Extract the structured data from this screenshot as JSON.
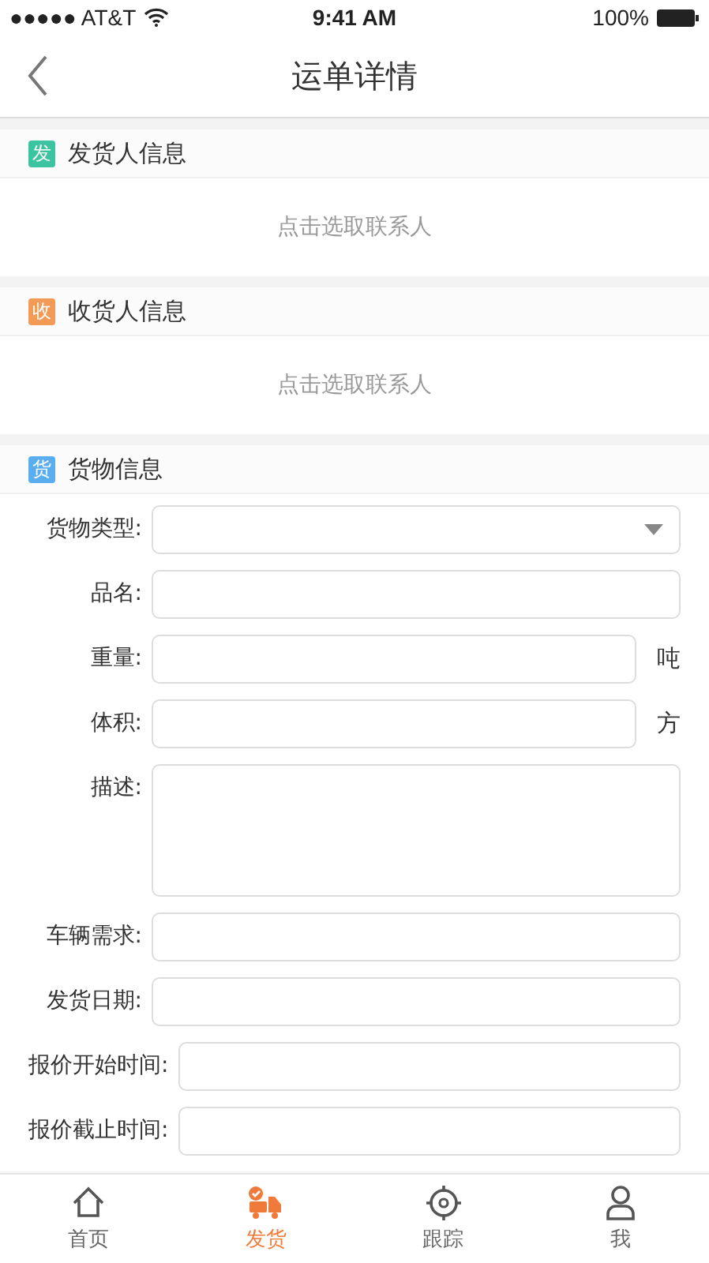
{
  "status_bar": {
    "carrier": "●●●●● AT&T",
    "time": "9:41 AM",
    "battery": "100%"
  },
  "nav": {
    "title": "运单详情"
  },
  "sections": [
    {
      "badge": "发",
      "color": "#3cc3a0",
      "title": "发货人信息",
      "kind": "picker",
      "prompt": "点击选取联系人"
    },
    {
      "badge": "收",
      "color": "#f39a57",
      "title": "收货人信息",
      "kind": "picker",
      "prompt": "点击选取联系人"
    },
    {
      "badge": "货",
      "color": "#5aaeef",
      "title": "货物信息",
      "kind": "form",
      "fields": [
        {
          "label": "货物类型:",
          "kind": "select"
        },
        {
          "label": "品名:",
          "kind": "text"
        },
        {
          "label": "重量:",
          "kind": "unit",
          "unit": "吨"
        },
        {
          "label": "体积:",
          "kind": "unit",
          "unit": "方"
        },
        {
          "label": "描述:",
          "kind": "textarea"
        },
        {
          "label": "车辆需求:",
          "kind": "text"
        },
        {
          "label": "发货日期:",
          "kind": "text"
        },
        {
          "label": "报价开始时间:",
          "kind": "text"
        },
        {
          "label": "报价截止时间:",
          "kind": "text"
        }
      ]
    }
  ],
  "tab_bar": [
    {
      "label": "首页",
      "selected": false
    },
    {
      "label": "发货",
      "selected": true
    },
    {
      "label": "跟踪",
      "selected": false
    },
    {
      "label": "我",
      "selected": false
    }
  ]
}
